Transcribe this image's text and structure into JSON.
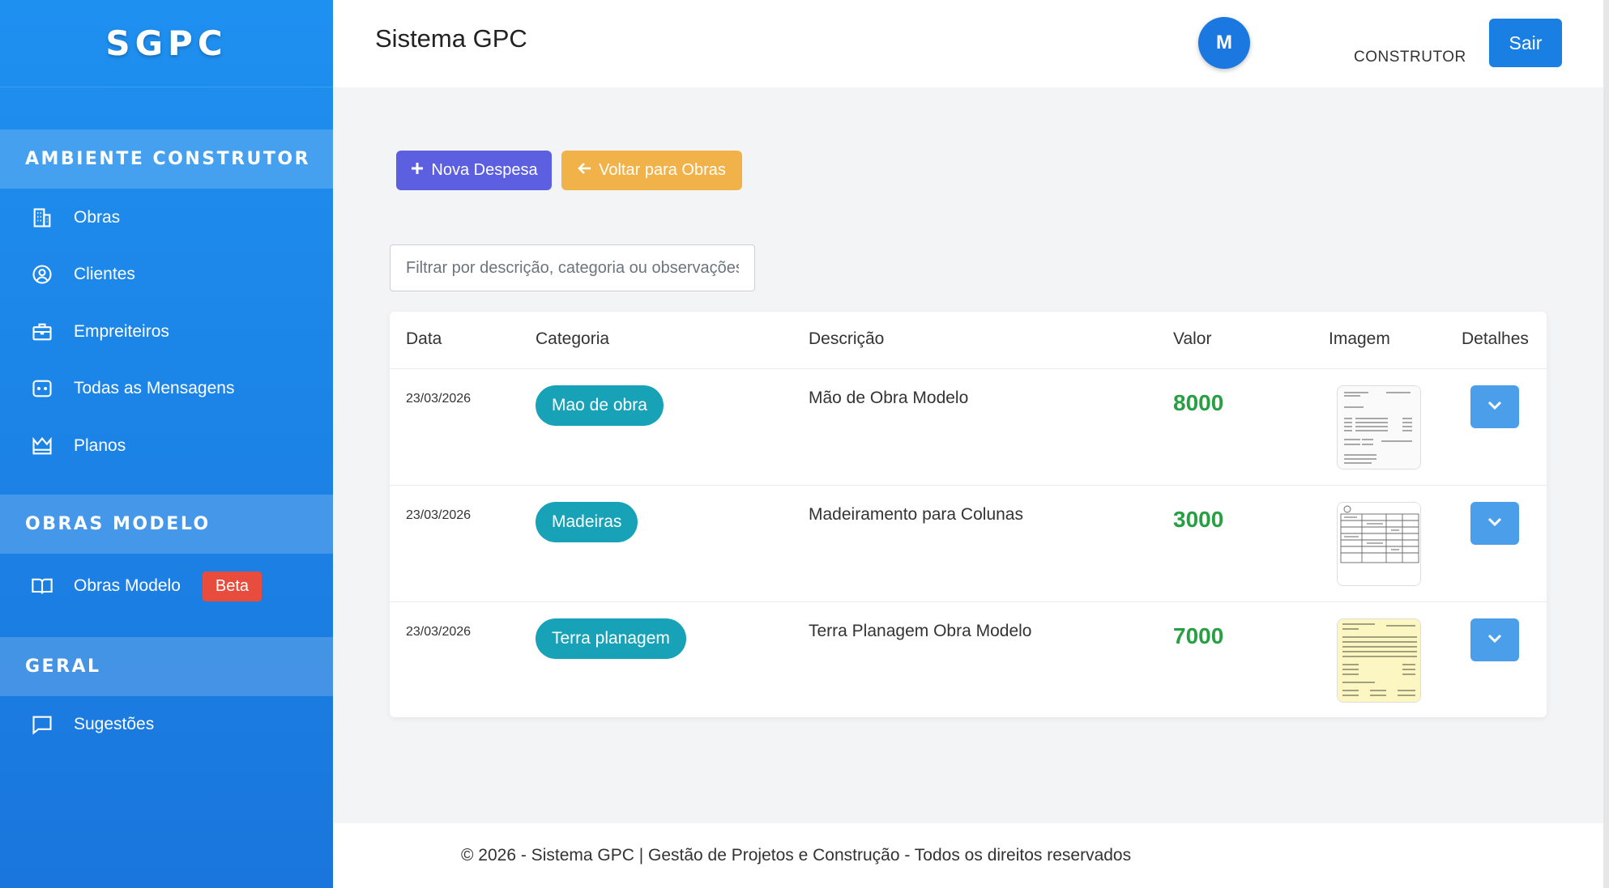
{
  "sidebar": {
    "brand": "SGPC",
    "sections": [
      {
        "title": "AMBIENTE CONSTRUTOR"
      },
      {
        "title": "OBRAS MODELO"
      },
      {
        "title": "GERAL"
      }
    ],
    "items": [
      {
        "label": "Obras",
        "icon": "building-icon"
      },
      {
        "label": "Clientes",
        "icon": "user-circle-icon"
      },
      {
        "label": "Empreiteiros",
        "icon": "briefcase-icon"
      },
      {
        "label": "Todas as Mensagens",
        "icon": "message-icon"
      },
      {
        "label": "Planos",
        "icon": "crown-icon"
      },
      {
        "label": "Obras Modelo",
        "icon": "book-icon",
        "badge": "Beta"
      },
      {
        "label": "Sugestões",
        "icon": "comment-icon"
      }
    ]
  },
  "header": {
    "title": "Sistema GPC",
    "avatar_initial": "M",
    "role": "CONSTRUTOR",
    "logout_label": "Sair"
  },
  "actions": {
    "new_expense": "Nova Despesa",
    "back_to_works": "Voltar para Obras"
  },
  "filter": {
    "placeholder": "Filtrar por descrição, categoria ou observações",
    "value": ""
  },
  "table": {
    "columns": [
      "Data",
      "Categoria",
      "Descrição",
      "Valor",
      "Imagem",
      "Detalhes"
    ],
    "rows": [
      {
        "date": "23/03/2026",
        "category": "Mao de obra",
        "description": "Mão de Obra Modelo",
        "value": "8000",
        "image": "receipt-thumbnail"
      },
      {
        "date": "23/03/2026",
        "category": "Madeiras",
        "description": "Madeiramento para Colunas",
        "value": "3000",
        "image": "invoice-thumbnail"
      },
      {
        "date": "23/03/2026",
        "category": "Terra planagem",
        "description": "Terra Planagem Obra Modelo",
        "value": "7000",
        "image": "yellow-receipt-thumbnail"
      }
    ]
  },
  "footer": {
    "text": "© 2026 - Sistema GPC | Gestão de Projetos e Construção - Todos os direitos reservados"
  },
  "colors": {
    "sidebar": "#1e88e5",
    "primary": "#1a7fe3",
    "new_button": "#5b5fe0",
    "back_button": "#f2b24a",
    "category_badge": "#17a2b8",
    "value_text": "#27a043",
    "beta_badge": "#e74c3c"
  }
}
